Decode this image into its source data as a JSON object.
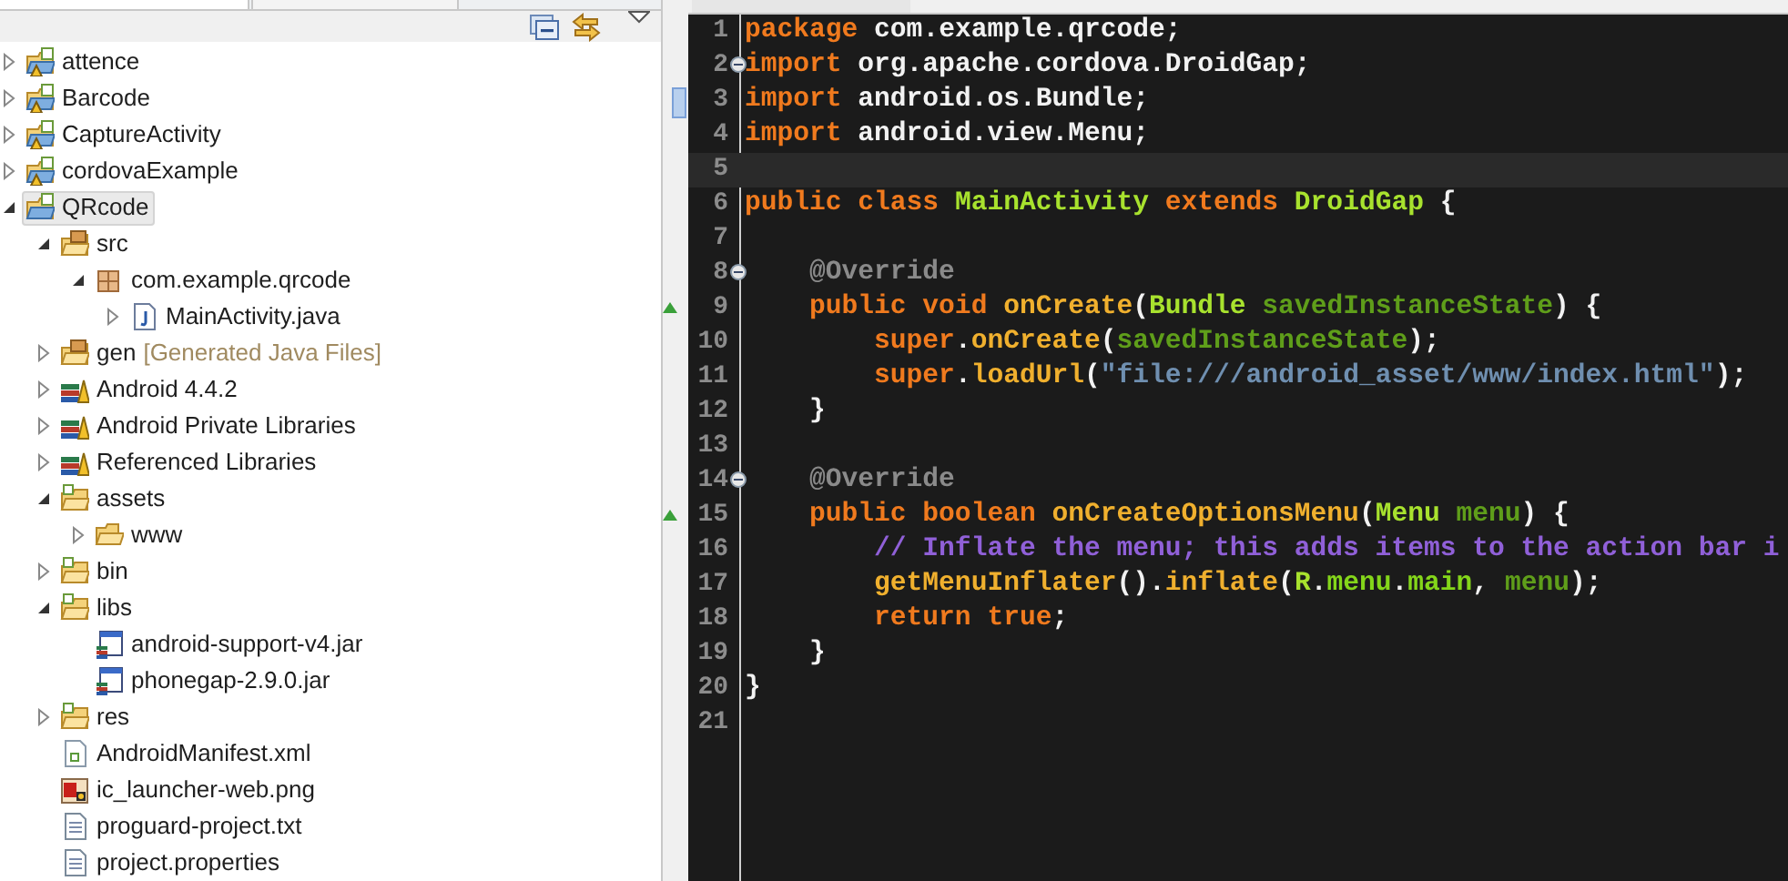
{
  "explorer": {
    "tree": [
      {
        "label": "attence",
        "kind": "project-warning",
        "expanded": false,
        "selected": false
      },
      {
        "label": "Barcode",
        "kind": "project-warning",
        "expanded": false,
        "selected": false
      },
      {
        "label": "CaptureActivity",
        "kind": "project-warning",
        "expanded": false,
        "selected": false
      },
      {
        "label": "cordovaExample",
        "kind": "project-warning",
        "expanded": false,
        "selected": false
      },
      {
        "label": "QRcode",
        "kind": "project",
        "expanded": true,
        "selected": true,
        "children": [
          {
            "label": "src",
            "kind": "source-folder",
            "expanded": true,
            "selected": false,
            "children": [
              {
                "label": "com.example.qrcode",
                "kind": "package",
                "expanded": true,
                "selected": false,
                "children": [
                  {
                    "label": "MainActivity.java",
                    "kind": "java-file",
                    "expanded": false,
                    "selected": false
                  }
                ]
              }
            ]
          },
          {
            "label": "gen",
            "decoration": "[Generated Java Files]",
            "kind": "source-folder",
            "expanded": false,
            "selected": false
          },
          {
            "label": "Android 4.4.2",
            "kind": "library",
            "expanded": false,
            "selected": false
          },
          {
            "label": "Android Private Libraries",
            "kind": "library",
            "expanded": false,
            "selected": false
          },
          {
            "label": "Referenced Libraries",
            "kind": "library",
            "expanded": false,
            "selected": false
          },
          {
            "label": "assets",
            "kind": "folder-linked",
            "expanded": true,
            "selected": false,
            "children": [
              {
                "label": "www",
                "kind": "folder",
                "expanded": false,
                "selected": false
              }
            ]
          },
          {
            "label": "bin",
            "kind": "folder-linked",
            "expanded": false,
            "selected": false
          },
          {
            "label": "libs",
            "kind": "folder-linked",
            "expanded": true,
            "selected": false,
            "children": [
              {
                "label": "android-support-v4.jar",
                "kind": "jar",
                "selected": false
              },
              {
                "label": "phonegap-2.9.0.jar",
                "kind": "jar",
                "selected": false
              }
            ]
          },
          {
            "label": "res",
            "kind": "folder-linked",
            "expanded": false,
            "selected": false
          },
          {
            "label": "AndroidManifest.xml",
            "kind": "xml-file",
            "selected": false
          },
          {
            "label": "ic_launcher-web.png",
            "kind": "image-file",
            "selected": false
          },
          {
            "label": "proguard-project.txt",
            "kind": "text-file",
            "selected": false
          },
          {
            "label": "project.properties",
            "kind": "text-file",
            "selected": false
          }
        ]
      }
    ]
  },
  "editor": {
    "lines": [
      {
        "number": "1",
        "fold": false,
        "override": false,
        "current": false,
        "ruler_mark": false,
        "tokens": [
          {
            "kind": "keyword",
            "text": "package"
          },
          {
            "kind": "plain",
            "text": " com.example.qrcode;"
          }
        ]
      },
      {
        "number": "2",
        "fold": true,
        "override": false,
        "current": false,
        "ruler_mark": false,
        "tokens": [
          {
            "kind": "keyword",
            "text": "import"
          },
          {
            "kind": "plain",
            "text": " org.apache.cordova.DroidGap;"
          }
        ]
      },
      {
        "number": "3",
        "fold": false,
        "override": false,
        "current": false,
        "ruler_mark": true,
        "tokens": [
          {
            "kind": "keyword",
            "text": "import"
          },
          {
            "kind": "plain",
            "text": " android.os.Bundle;"
          }
        ]
      },
      {
        "number": "4",
        "fold": false,
        "override": false,
        "current": false,
        "ruler_mark": false,
        "tokens": [
          {
            "kind": "keyword",
            "text": "import"
          },
          {
            "kind": "plain",
            "text": " android.view.Menu;"
          }
        ]
      },
      {
        "number": "5",
        "fold": false,
        "override": false,
        "current": true,
        "ruler_mark": false
      },
      {
        "number": "6",
        "fold": false,
        "override": false,
        "current": false,
        "ruler_mark": false,
        "tokens": [
          {
            "kind": "keyword",
            "text": "public class"
          },
          {
            "kind": "class",
            "text": " MainActivity"
          },
          {
            "kind": "keyword",
            "text": " extends"
          },
          {
            "kind": "class",
            "text": " DroidGap"
          },
          {
            "kind": "plain",
            "text": " {"
          }
        ]
      },
      {
        "number": "7",
        "fold": false,
        "override": false,
        "current": false,
        "ruler_mark": false
      },
      {
        "number": "8",
        "fold": true,
        "override": false,
        "current": false,
        "ruler_mark": false,
        "tokens": [
          {
            "kind": "annotation",
            "text": "    @Override"
          }
        ]
      },
      {
        "number": "9",
        "fold": false,
        "override": true,
        "current": false,
        "ruler_mark": false,
        "tokens": [
          {
            "kind": "keyword",
            "text": "    public void"
          },
          {
            "kind": "method",
            "text": " onCreate"
          },
          {
            "kind": "plain",
            "text": "("
          },
          {
            "kind": "class",
            "text": "Bundle"
          },
          {
            "kind": "param",
            "text": " savedInstanceState"
          },
          {
            "kind": "plain",
            "text": ") {"
          }
        ]
      },
      {
        "number": "10",
        "fold": false,
        "override": false,
        "current": false,
        "ruler_mark": false,
        "tokens": [
          {
            "kind": "keyword",
            "text": "        super"
          },
          {
            "kind": "plain",
            "text": "."
          },
          {
            "kind": "method",
            "text": "onCreate"
          },
          {
            "kind": "plain",
            "text": "("
          },
          {
            "kind": "param",
            "text": "savedInstanceState"
          },
          {
            "kind": "plain",
            "text": ");"
          }
        ]
      },
      {
        "number": "11",
        "fold": false,
        "override": false,
        "current": false,
        "ruler_mark": false,
        "tokens": [
          {
            "kind": "keyword",
            "text": "        super"
          },
          {
            "kind": "plain",
            "text": "."
          },
          {
            "kind": "method",
            "text": "loadUrl"
          },
          {
            "kind": "plain",
            "text": "("
          },
          {
            "kind": "string",
            "text": "\"file:///android_asset/www/index.html\""
          },
          {
            "kind": "plain",
            "text": ");"
          }
        ]
      },
      {
        "number": "12",
        "fold": false,
        "override": false,
        "current": false,
        "ruler_mark": false,
        "tokens": [
          {
            "kind": "plain",
            "text": "    }"
          }
        ]
      },
      {
        "number": "13",
        "fold": false,
        "override": false,
        "current": false,
        "ruler_mark": false
      },
      {
        "number": "14",
        "fold": true,
        "override": false,
        "current": false,
        "ruler_mark": false,
        "tokens": [
          {
            "kind": "annotation",
            "text": "    @Override"
          }
        ]
      },
      {
        "number": "15",
        "fold": false,
        "override": true,
        "current": false,
        "ruler_mark": false,
        "tokens": [
          {
            "kind": "keyword",
            "text": "    public boolean"
          },
          {
            "kind": "method",
            "text": " onCreateOptionsMenu"
          },
          {
            "kind": "plain",
            "text": "("
          },
          {
            "kind": "class",
            "text": "Menu"
          },
          {
            "kind": "param",
            "text": " menu"
          },
          {
            "kind": "plain",
            "text": ") {"
          }
        ]
      },
      {
        "number": "16",
        "fold": false,
        "override": false,
        "current": false,
        "ruler_mark": false,
        "tokens": [
          {
            "kind": "comment",
            "text": "        // Inflate the menu; this adds items to the action bar i"
          }
        ]
      },
      {
        "number": "17",
        "fold": false,
        "override": false,
        "current": false,
        "ruler_mark": false,
        "tokens": [
          {
            "kind": "method",
            "text": "        getMenuInflater"
          },
          {
            "kind": "plain",
            "text": "()."
          },
          {
            "kind": "method",
            "text": "inflate"
          },
          {
            "kind": "plain",
            "text": "("
          },
          {
            "kind": "class",
            "text": "R"
          },
          {
            "kind": "plain",
            "text": "."
          },
          {
            "kind": "field",
            "text": "menu"
          },
          {
            "kind": "plain",
            "text": "."
          },
          {
            "kind": "field",
            "text": "main"
          },
          {
            "kind": "plain",
            "text": ","
          },
          {
            "kind": "param",
            "text": " menu"
          },
          {
            "kind": "plain",
            "text": ");"
          }
        ]
      },
      {
        "number": "18",
        "fold": false,
        "override": false,
        "current": false,
        "ruler_mark": false,
        "tokens": [
          {
            "kind": "keyword",
            "text": "        return true"
          },
          {
            "kind": "plain",
            "text": ";"
          }
        ]
      },
      {
        "number": "19",
        "fold": false,
        "override": false,
        "current": false,
        "ruler_mark": false,
        "tokens": [
          {
            "kind": "plain",
            "text": "    }"
          }
        ]
      },
      {
        "number": "20",
        "fold": false,
        "override": false,
        "current": false,
        "ruler_mark": false,
        "tokens": [
          {
            "kind": "plain",
            "text": "}"
          }
        ]
      },
      {
        "number": "21",
        "fold": false,
        "override": false,
        "current": false,
        "ruler_mark": false
      }
    ]
  }
}
